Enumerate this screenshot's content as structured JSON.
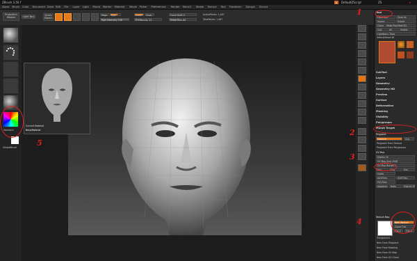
{
  "window": {
    "title": "ZBrush 3.50 f",
    "doc_name": "DefaultZScript",
    "right_title": "ZS"
  },
  "menu": [
    "Alpha",
    "Brush",
    "Color",
    "Document",
    "Draw",
    "Edit",
    "File",
    "Layer",
    "Light",
    "Macro",
    "Marker",
    "Material",
    "Movie",
    "Picker",
    "Preferences",
    "Render",
    "Stencil",
    "Stroke",
    "Texture",
    "Tool",
    "Transform",
    "Zplugin",
    "Zscript"
  ],
  "shelf": {
    "projection_master": "Projection Master",
    "lightbox": "Light Box",
    "quick_sketch": "Quick Sketch",
    "edit": "Edit",
    "draw": "Draw",
    "move": "Move",
    "scale": "Scale",
    "rotate": "Rotate",
    "mrgb": "Mrgb",
    "rgb": "Rgb",
    "m": "M",
    "rgb_intensity": "Rgb Intensity 100",
    "zadd": "Zadd",
    "zsub": "Zsub",
    "z_intensity": "Z Intensity 25",
    "focal_shift": "Focal Shift 0",
    "draw_size": "Draw Size 64",
    "active_points": "ActivePoints: 1,487",
    "total_points": "TotalPoints: 1,487"
  },
  "left_tray": {
    "brush_label": "Standard",
    "texture_label": "SimpleBrush"
  },
  "popup": {
    "current_material_label": "Current Material",
    "material_name": "BasicMaterial"
  },
  "palette": {
    "title": "Tool",
    "load_tool": "Load Tool",
    "save_as": "Save As",
    "import": "Import",
    "export": "Export",
    "clone": "Clone",
    "make_polymesh": "Make PolyMesh3D",
    "goz": "GoZ",
    "all": "All",
    "visible": "Visible",
    "lightbox_tools": "Lightbox ▸ Tools",
    "tool_name": "DefaultHead 48",
    "subtools": [
      "SubTool",
      "Layers",
      "Geometry",
      "Geometry HD",
      "Preview",
      "Surface",
      "Deformation",
      "Masking",
      "Visibility",
      "Polygroups",
      "Morph Target"
    ],
    "polypaint_header": "Polypaint",
    "colorize": "Colorize",
    "grd": "Grd",
    "polypaint_from_texture": "Polypaint From Texture",
    "polypaint_from_polygroups": "Polypaint From Polygroups",
    "uv_map_header": "UV Map",
    "uv_items": [
      "Delete UV",
      "UV Map Size 2048",
      "UV Map Border 4",
      "Uvc",
      "Uvp",
      "Uvs",
      "Uvtile",
      "AUVTiles",
      "GUVTiles",
      "PUVTiles",
      "Adaptive",
      "Ratio",
      "Hybrid UV"
    ],
    "texture_map_header": "Texture Map",
    "new_texture": "New Texture",
    "clone_txtr": "Clone Txtr",
    "flip_v": "Flip V",
    "flip_h": "Flip H",
    "transparent": "Transparent",
    "new_from_polypaint": "New From Polypaint",
    "new_from_masking": "New From Masking",
    "new_from_uv_map": "New From UV Map",
    "new_from_uv_check": "New From UV Check"
  },
  "annotations": [
    "1",
    "2",
    "3",
    "4",
    "5"
  ],
  "colors": {
    "accent": "#e2741a",
    "annotation": "#e02020"
  }
}
